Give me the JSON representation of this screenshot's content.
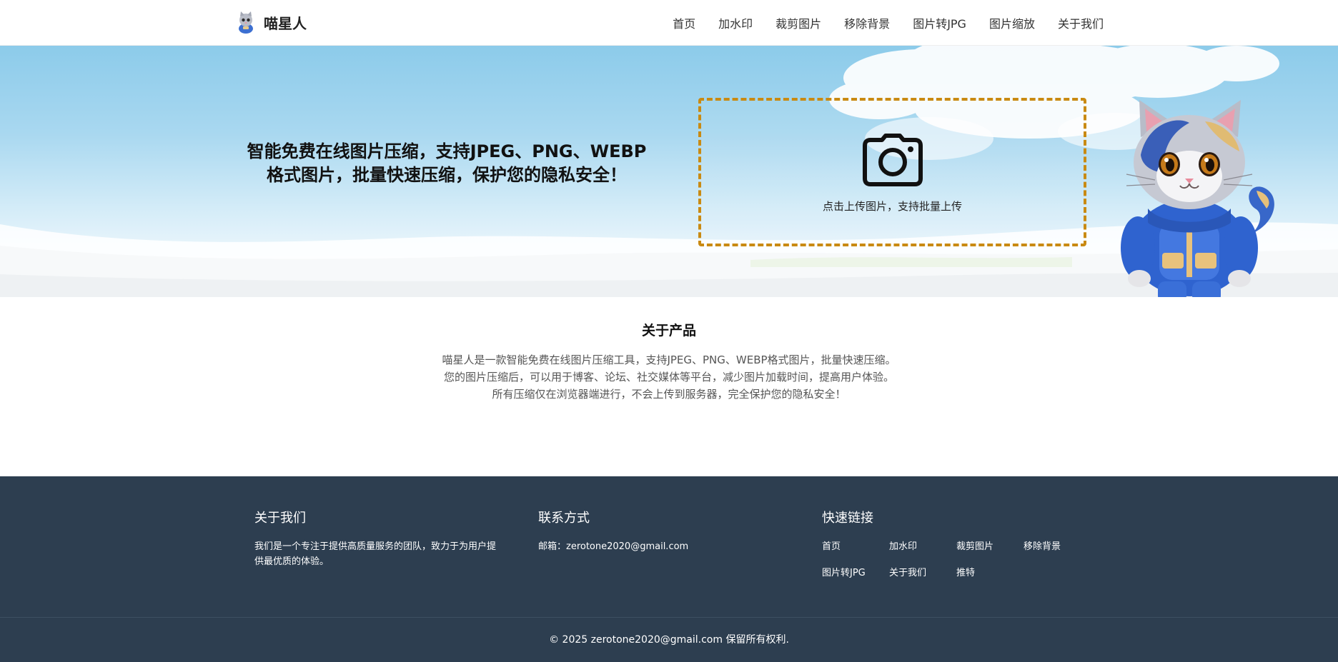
{
  "header": {
    "logo_text": "喵星人",
    "nav": [
      "首页",
      "加水印",
      "裁剪图片",
      "移除背景",
      "图片转JPG",
      "图片缩放",
      "关于我们"
    ]
  },
  "hero": {
    "title_line1": "智能免费在线图片压缩，支持JPEG、PNG、WEBP",
    "title_line2": "格式图片，批量快速压缩，保护您的隐私安全！",
    "upload_text": "点击上传图片，支持批量上传",
    "upload_border_color": "#c98a12"
  },
  "about": {
    "title": "关于产品",
    "lines": [
      "喵星人是一款智能免费在线图片压缩工具，支持JPEG、PNG、WEBP格式图片，批量快速压缩。",
      "您的图片压缩后，可以用于博客、论坛、社交媒体等平台，减少图片加载时间，提高用户体验。",
      "所有压缩仅在浏览器端进行，不会上传到服务器，完全保护您的隐私安全！"
    ]
  },
  "footer": {
    "background": "#2d3e50",
    "about_title": "关于我们",
    "about_text_line1": "我们是一个专注于提供高质量服务的团队，致力于为用户提",
    "about_text_line2": "供最优质的体验。",
    "contact_title": "联系方式",
    "contact_email": "邮箱：zerotone2020@gmail.com",
    "links_title": "快速链接",
    "links": [
      "首页",
      "加水印",
      "裁剪图片",
      "移除背景",
      "图片转JPG",
      "关于我们",
      "推特"
    ],
    "copyright": "© 2025 zerotone2020@gmail.com 保留所有权利."
  },
  "icons": {
    "logo": "cat-mascot-icon",
    "upload": "camera-icon",
    "hero_art": "cat-mascot-illustration"
  }
}
